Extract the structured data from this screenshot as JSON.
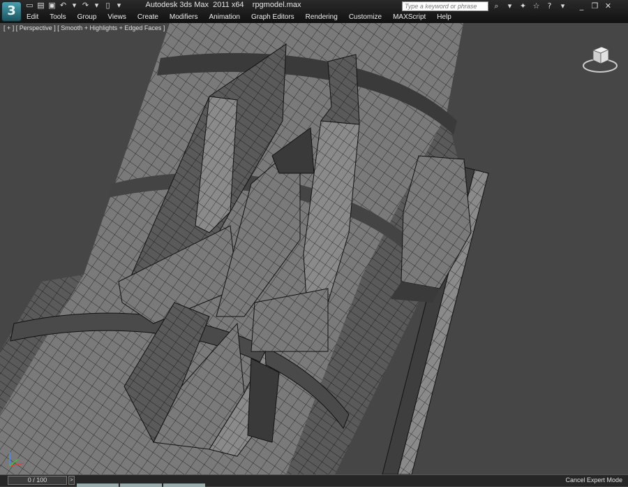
{
  "window": {
    "title": "Autodesk 3ds Max  2011 x64    rpgmodel.max",
    "logo_letter": "3"
  },
  "quick_access": [
    {
      "name": "new-file-icon",
      "glyph": "▭"
    },
    {
      "name": "open-file-icon",
      "glyph": "▤"
    },
    {
      "name": "save-icon",
      "glyph": "▣"
    },
    {
      "name": "undo-icon",
      "glyph": "↶"
    },
    {
      "name": "undo-dropdown-icon",
      "glyph": "▾"
    },
    {
      "name": "redo-icon",
      "glyph": "↷"
    },
    {
      "name": "redo-dropdown-icon",
      "glyph": "▾"
    },
    {
      "name": "project-folder-icon",
      "glyph": "▯"
    },
    {
      "name": "qat-dropdown-icon",
      "glyph": "▾"
    }
  ],
  "menu": [
    "Edit",
    "Tools",
    "Group",
    "Views",
    "Create",
    "Modifiers",
    "Animation",
    "Graph Editors",
    "Rendering",
    "Customize",
    "MAXScript",
    "Help"
  ],
  "search": {
    "placeholder": "Type a keyword or phrase",
    "value": ""
  },
  "toolbar_right": [
    {
      "name": "search-icon",
      "glyph": "⌕"
    },
    {
      "name": "search-dropdown-icon",
      "glyph": "▾"
    },
    {
      "name": "communication-center-icon",
      "glyph": "✦"
    },
    {
      "name": "favorites-icon",
      "glyph": "☆"
    },
    {
      "name": "help-icon",
      "glyph": "?"
    },
    {
      "name": "help-dropdown-icon",
      "glyph": "▾"
    },
    {
      "name": "minimize-icon",
      "glyph": "_"
    },
    {
      "name": "restore-icon",
      "glyph": "❐"
    },
    {
      "name": "close-icon",
      "glyph": "✕"
    }
  ],
  "viewport": {
    "label": "[ + ] [ Perspective ] [ Smooth + Highlights + Edged Faces ]",
    "background": "#464646",
    "mesh_fill": "#7b7b7b",
    "mesh_shadow": "#4c4c4c",
    "wire_color": "#111111"
  },
  "status": {
    "time_slider": "0 / 100",
    "message": "Cancel Expert Mode"
  }
}
